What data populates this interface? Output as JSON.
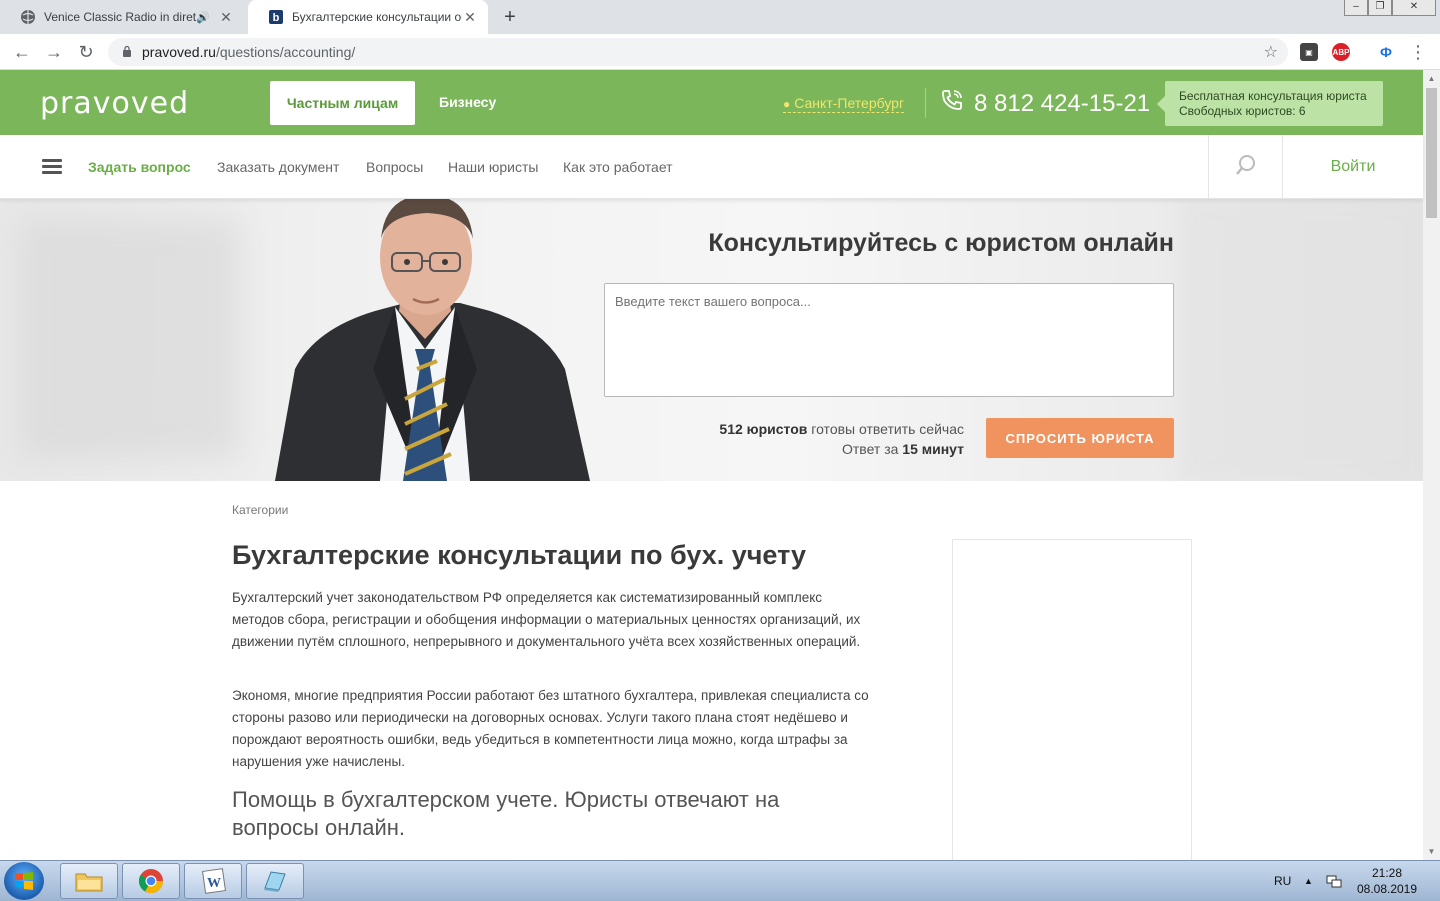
{
  "browser": {
    "tabs": [
      {
        "title": "Venice Classic Radio in diretta",
        "active": false,
        "icon": "globe-icon"
      },
      {
        "title": "Бухгалтерские консультации онлайн",
        "active": true,
        "icon": "pravoved-favicon"
      }
    ],
    "newtab_label": "+",
    "url_host": "pravoved.ru",
    "url_path": "/questions/accounting/",
    "ext_abp_label": "ABP"
  },
  "site": {
    "logo": "pravoved",
    "header": {
      "private_label": "Частным лицам",
      "business_label": "Бизнесу",
      "city": "Санкт-Петербург",
      "phone": "8 812 424-15-21",
      "consult_line1": "Бесплатная консультация юриста",
      "consult_line2": "Свободных юристов: 6"
    },
    "nav": {
      "items": [
        "Задать вопрос",
        "Заказать документ",
        "Вопросы",
        "Наши юристы",
        "Как это работает"
      ],
      "login": "Войти"
    },
    "hero": {
      "title": "Консультируйтесь с юристом онлайн",
      "placeholder": "Введите текст вашего вопроса...",
      "lawyers_count": "512 юристов",
      "lawyers_text": " готовы ответить сейчас",
      "answer_prefix": "Ответ за ",
      "answer_time": "15 минут",
      "ask_button": "СПРОСИТЬ ЮРИСТА"
    },
    "content": {
      "breadcrumb": "Категории",
      "h1": "Бухгалтерские консультации по бух. учету",
      "p1": "Бухгалтерский учет законодательством РФ определяется как систематизированный комплекс методов сбора, регистрации и обобщения информации о материальных ценностях организаций, их движении путём сплошного, непрерывного и документального учёта всех хозяйственных операций.",
      "p2": "Экономя, многие предприятия России работают без штатного бухгалтера, привлекая специалиста со стороны разово или периодически на договорных основах. Услуги такого плана стоят недёшево и порождают вероятность ошибки, ведь убедиться в компетентности лица можно, когда штрафы за нарушения уже начислены.",
      "h2": "Помощь в бухгалтерском учете. Юристы отвечают на вопросы онлайн."
    }
  },
  "taskbar": {
    "lang": "RU",
    "time": "21:28",
    "date": "08.08.2019"
  },
  "colors": {
    "brand_green": "#7cb65a",
    "accent_orange": "#f0935e",
    "city_yellow": "#f0e66a"
  }
}
